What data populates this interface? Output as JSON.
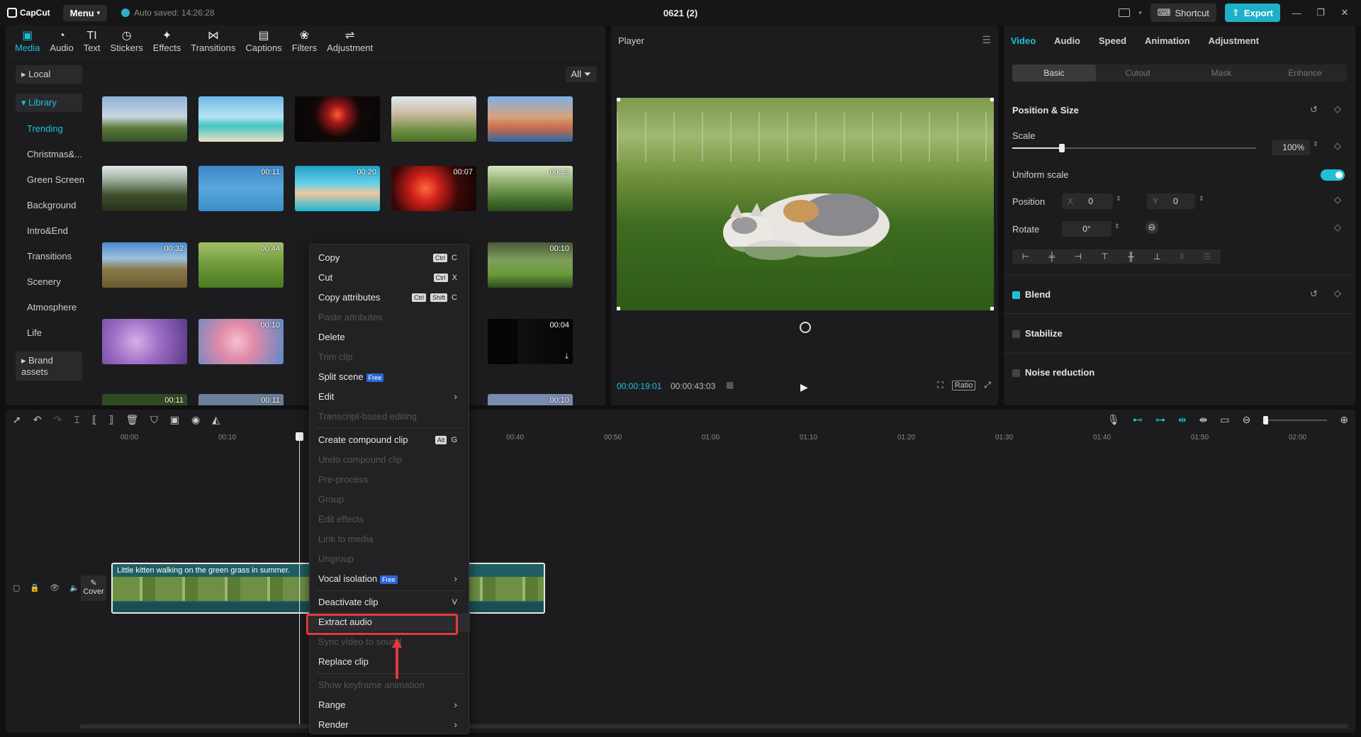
{
  "titlebar": {
    "app_name": "CapCut",
    "menu_label": "Menu",
    "autosave": "Auto saved: 14:26:28",
    "doc_title": "0621 (2)",
    "shortcut_label": "Shortcut",
    "export_label": "Export",
    "minimize": "—",
    "maximize": "❐",
    "close": "✕"
  },
  "media": {
    "tools": [
      {
        "label": "Media",
        "icon": "▣"
      },
      {
        "label": "Audio",
        "icon": "◔"
      },
      {
        "label": "Text",
        "icon": "TI"
      },
      {
        "label": "Stickers",
        "icon": "◷"
      },
      {
        "label": "Effects",
        "icon": "✦"
      },
      {
        "label": "Transitions",
        "icon": "⋈"
      },
      {
        "label": "Captions",
        "icon": "▤"
      },
      {
        "label": "Filters",
        "icon": "❀"
      },
      {
        "label": "Adjustment",
        "icon": "⇌"
      }
    ],
    "categories": {
      "local": "▸ Local",
      "library": "▾ Library",
      "trending": "Trending",
      "christmas": "Christmas&...",
      "green_screen": "Green Screen",
      "background": "Background",
      "intro_end": "Intro&End",
      "transitions": "Transitions",
      "scenery": "Scenery",
      "atmosphere": "Atmosphere",
      "life": "Life",
      "brand_assets": "▸ Brand assets"
    },
    "filter_label": "All",
    "durations": {
      "r2c2": "00:11",
      "r2c3": "00:20",
      "r2c4": "00:07",
      "r2c5": "00:13",
      "r3c1": "00:32",
      "r3c2": "00:44",
      "r3c5": "00:10",
      "r4c2": "00:10",
      "r4c5": "00:04",
      "r5c1": "00:11",
      "r5c2": "00:11",
      "r5c5": "00:10"
    }
  },
  "player": {
    "title": "Player",
    "current_time": "00:00:19:01",
    "total_time": "00:00:43:03",
    "ratio_label": "Ratio"
  },
  "props": {
    "tabs": [
      "Video",
      "Audio",
      "Speed",
      "Animation",
      "Adjustment"
    ],
    "segments": [
      "Basic",
      "Cutout",
      "Mask",
      "Enhance"
    ],
    "position_size": "Position & Size",
    "scale_label": "Scale",
    "scale_value": "100%",
    "uniform_scale": "Uniform scale",
    "position_label": "Position",
    "pos_x_label": "X",
    "pos_x": "0",
    "pos_y_label": "Y",
    "pos_y": "0",
    "rotate_label": "Rotate",
    "rotate_value": "0°",
    "blend": "Blend",
    "stabilize": "Stabilize",
    "noise_reduction": "Noise reduction"
  },
  "timeline": {
    "ruler": [
      "00:00",
      "00:10",
      "00:40",
      "00:50",
      "01:00",
      "01:10",
      "01:20",
      "01:30",
      "01:40",
      "01:50",
      "02:00"
    ],
    "cover_label": "Cover",
    "clip_title": "Little kitten walking on the green grass in summer."
  },
  "context_menu": {
    "copy": "Copy",
    "copy_key": "C",
    "cut": "Cut",
    "cut_key": "X",
    "copy_attributes": "Copy attributes",
    "copy_attr_key": "C",
    "paste_attributes": "Paste attributes",
    "delete": "Delete",
    "trim_clip": "Trim clip",
    "split_scene": "Split scene",
    "free_badge": "Free",
    "edit": "Edit",
    "transcript_editing": "Transcript-based editing",
    "create_compound": "Create compound clip",
    "create_compound_key": "G",
    "undo_compound": "Undo compound clip",
    "pre_process": "Pre-process",
    "group": "Group",
    "edit_effects": "Edit effects",
    "link_media": "Link to media",
    "ungroup": "Ungroup",
    "vocal_isolation": "Vocal isolation",
    "deactivate_clip": "Deactivate clip",
    "deactivate_key": "V",
    "extract_audio": "Extract audio",
    "sync_video": "Sync video to sound",
    "replace_clip": "Replace clip",
    "show_keyframe": "Show keyframe animation",
    "range": "Range",
    "render": "Render",
    "key_ctrl": "Ctrl",
    "key_shift": "Shift",
    "key_alt": "Alt"
  },
  "colors": {
    "accent": "#1fc0d6",
    "highlight": "#e23a3a"
  }
}
